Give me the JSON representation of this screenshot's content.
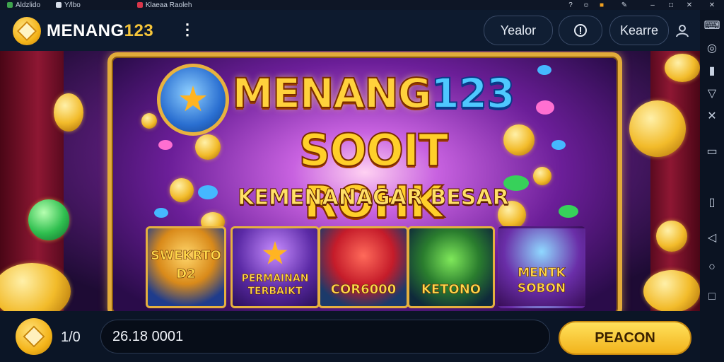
{
  "os_bar": {
    "tabs": [
      {
        "label": "Aldzlido",
        "icon": "app-icon"
      },
      {
        "label": "Y/lbo",
        "icon": "window-icon"
      },
      {
        "label": "Klaeaa Raoleh",
        "icon": "browser-tab-icon"
      }
    ],
    "controls": [
      "help-icon",
      "user-icon",
      "warning-icon",
      "settings-icon",
      "minimize-icon",
      "maximize-icon",
      "close-icon"
    ]
  },
  "header": {
    "logo_text": "MENANG",
    "logo_num": "123",
    "more_icon": "more-vertical-icon",
    "buttons": [
      {
        "label": "Yealor"
      },
      {
        "label": "",
        "icon": "info-icon"
      },
      {
        "label": "Kearre"
      }
    ],
    "profile_icon": "user-icon"
  },
  "sidebar": {
    "icons": [
      "keyboard-icon",
      "camera-icon",
      "record-icon",
      "shield-icon",
      "shuffle-icon",
      "tablet-icon",
      "device-icon",
      "back-icon",
      "home-icon",
      "recent-icon"
    ]
  },
  "banner": {
    "title_a": "MENANG",
    "title_b": "123",
    "title_line2": "SOOIT ROHK",
    "title_line3": "KEMENANAGAR BESAR",
    "cards": [
      {
        "label": "SWEKRTO D2"
      },
      {
        "label": "PERMAINAN TERBAIKT"
      },
      {
        "label": "COR6000"
      },
      {
        "label": "KETONO"
      },
      {
        "label": "MENTK SOBON"
      }
    ]
  },
  "bottom_bar": {
    "coin_icon": "coin-icon",
    "count": "1/0",
    "input_value": "26.18 0001",
    "action_label": "PEACON"
  },
  "colors": {
    "gold": "#f4b41a",
    "header_bg": "#0d1a2e",
    "accent_blue": "#4ec8ff"
  }
}
